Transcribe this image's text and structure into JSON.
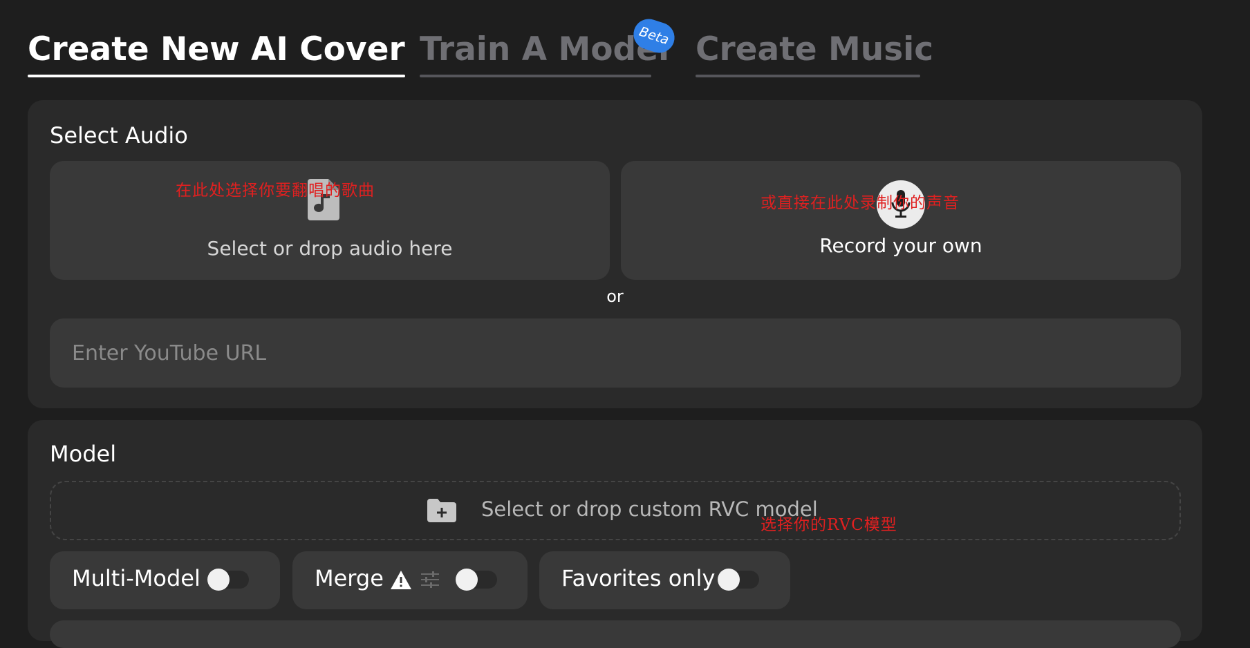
{
  "tabs": [
    {
      "label": "Create New AI Cover",
      "active": true
    },
    {
      "label": "Train A Model",
      "active": false,
      "badge": "Beta"
    },
    {
      "label": "Create Music",
      "active": false
    }
  ],
  "select_audio": {
    "title": "Select Audio",
    "select_label": "Select or drop audio here",
    "select_icon": "music-file-icon",
    "record_label": "Record your own",
    "record_icon": "microphone-icon",
    "or_text": "or",
    "youtube_placeholder": "Enter YouTube URL",
    "youtube_value": ""
  },
  "model": {
    "title": "Model",
    "dropzone_label": "Select or drop custom RVC model",
    "dropzone_icon": "folder-plus-icon",
    "toggles": [
      {
        "label": "Multi-Model",
        "on": false
      },
      {
        "label": "Merge",
        "on": false,
        "icons": [
          "warning-icon",
          "sliders-icon"
        ]
      },
      {
        "label": "Favorites only",
        "on": false
      }
    ]
  },
  "annotations": {
    "select_song": "在此处选择你要翻唱的歌曲",
    "record_voice": "或直接在此处录制你的声音",
    "select_model": "选择你的RVC模型"
  },
  "colors": {
    "background": "#1e1e1e",
    "card": "#2a2a2a",
    "panel": "#393939",
    "beta_badge": "#2f7fe6",
    "annotation": "#e02020"
  }
}
